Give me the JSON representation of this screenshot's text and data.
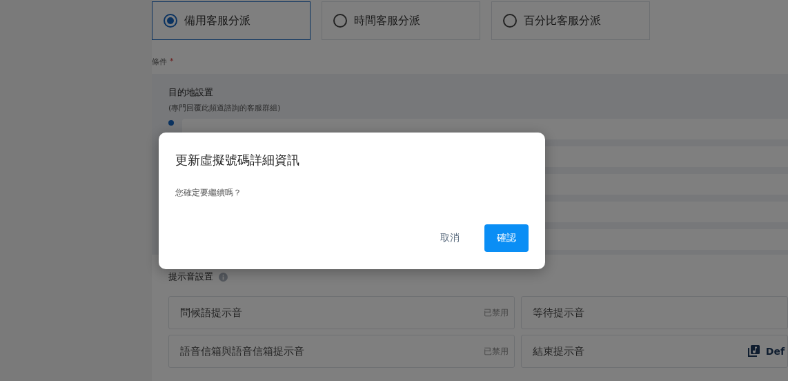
{
  "methods": [
    {
      "label": "備用客服分派",
      "selected": true
    },
    {
      "label": "時間客服分派",
      "selected": false
    },
    {
      "label": "百分比客服分派",
      "selected": false
    }
  ],
  "conditions": {
    "label": "條件",
    "marker": "*"
  },
  "destination": {
    "title": "目的地設置",
    "subtitle": "(專門回覆此頻道諮詢的客服群組)"
  },
  "sounds": {
    "title": "提示音設置",
    "items": [
      {
        "kind": "status",
        "label": "問候語提示音",
        "status": "已禁用"
      },
      {
        "kind": "plain",
        "label": "等待提示音"
      },
      {
        "kind": "status",
        "label": "語音信箱與語音信箱提示音",
        "status": "已禁用"
      },
      {
        "kind": "file",
        "label": "結束提示音",
        "value": "Def"
      }
    ]
  },
  "dialog": {
    "title": "更新虛擬號碼詳細資訊",
    "message": "您確定要繼續嗎？",
    "buttons": [
      {
        "kind": "text",
        "label": "取消"
      },
      {
        "kind": "primary",
        "label": "確認"
      }
    ]
  }
}
